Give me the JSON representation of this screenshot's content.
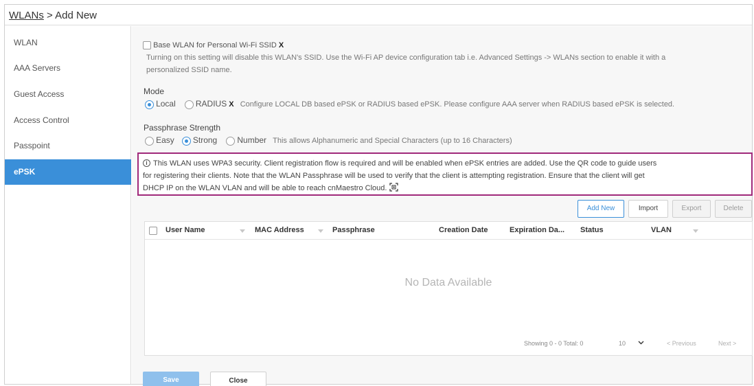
{
  "breadcrumb": {
    "parent": "WLANs",
    "separator": " > ",
    "current": "Add New"
  },
  "sidebar": {
    "items": [
      {
        "label": "WLAN"
      },
      {
        "label": "AAA Servers"
      },
      {
        "label": "Guest Access"
      },
      {
        "label": "Access Control"
      },
      {
        "label": "Passpoint"
      },
      {
        "label": "ePSK",
        "active": true
      }
    ]
  },
  "base_wlan": {
    "label": "Base WLAN for Personal Wi-Fi SSID",
    "x_mark": "X",
    "checked": false,
    "help_line1": "Turning on this setting will disable this WLAN's SSID. Use the Wi-Fi AP device configuration tab i.e. Advanced Settings -> WLANs section to enable it with a",
    "help_line2": "personalized SSID name."
  },
  "mode": {
    "label": "Mode",
    "options": [
      {
        "label": "Local",
        "selected": true
      },
      {
        "label": "RADIUS",
        "selected": false
      }
    ],
    "x_mark": "X",
    "help": "Configure LOCAL DB based ePSK or RADIUS based ePSK. Please configure AAA server when RADIUS based ePSK is selected."
  },
  "passphrase_strength": {
    "label": "Passphrase Strength",
    "options": [
      {
        "label": "Easy",
        "selected": false
      },
      {
        "label": "Strong",
        "selected": true
      },
      {
        "label": "Number",
        "selected": false
      }
    ],
    "help": "This allows Alphanumeric and Special Characters (up to 16 Characters)"
  },
  "notice": {
    "line1": "This WLAN uses WPA3 security. Client registration flow is required and will be enabled when ePSK entries are added. Use the QR code to guide users",
    "line2": "for registering their clients. Note that the WLAN Passphrase will be used to verify that the client is attempting registration. Ensure that the client will get",
    "line3": "DHCP IP on the WLAN VLAN and will be able to reach cnMaestro Cloud.",
    "border_color": "#a0287a"
  },
  "toolbar": {
    "add_new": "Add New",
    "import": "Import",
    "export": "Export",
    "delete": "Delete"
  },
  "table": {
    "columns": [
      "User Name",
      "MAC Address",
      "Passphrase",
      "Creation Date",
      "Expiration Da...",
      "Status",
      "VLAN"
    ],
    "rows": [],
    "empty_message": "No Data Available"
  },
  "pager": {
    "showing": "Showing 0 - 0 Total: 0",
    "page_size": "10",
    "previous": "< Previous",
    "next": "Next >"
  },
  "footer": {
    "save": "Save",
    "close": "Close"
  },
  "colors": {
    "accent": "#3a8fd9",
    "save_button": "#8fc0ec"
  }
}
